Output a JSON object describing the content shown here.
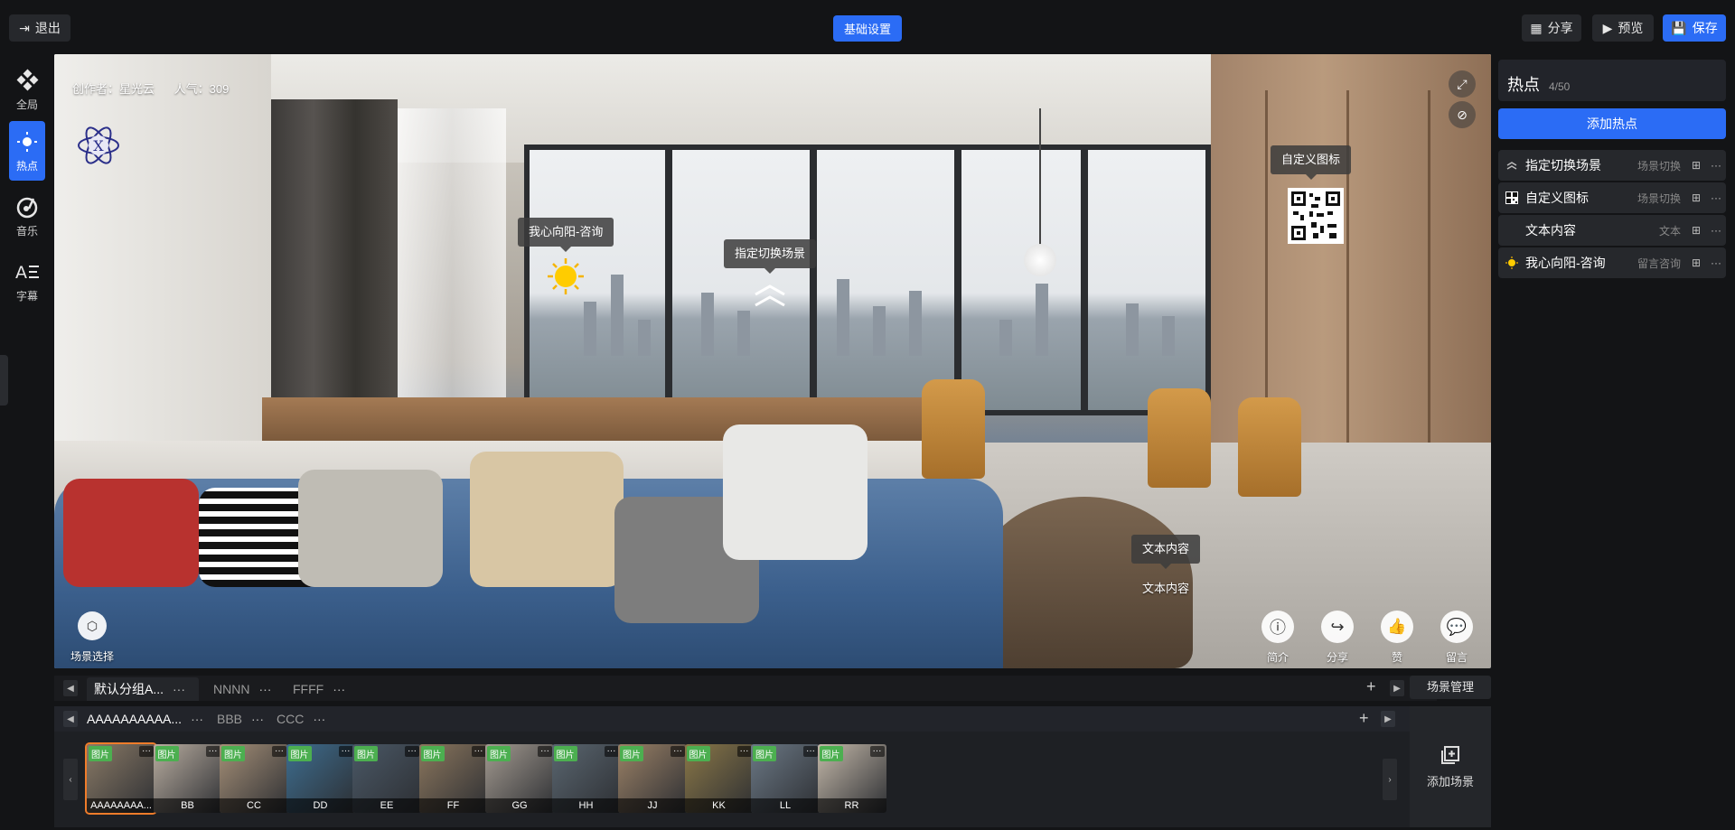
{
  "topbar": {
    "exit_label": "退出",
    "basic_settings_label": "基础设置",
    "share_label": "分享",
    "preview_label": "预览",
    "save_label": "保存"
  },
  "leftnav": [
    {
      "label": "全局",
      "icon": "global-icon"
    },
    {
      "label": "热点",
      "icon": "hotspot-icon",
      "active": true
    },
    {
      "label": "音乐",
      "icon": "music-icon"
    },
    {
      "label": "字幕",
      "icon": "subtitle-icon"
    }
  ],
  "viewer": {
    "creator_label": "创作者：星光云",
    "popularity_label": "人气：309",
    "logo_letter": "X",
    "hotspots": {
      "consult": "我心向阳-咨询",
      "scene_switch": "指定切换场景",
      "custom_icon": "自定义图标",
      "text_tip": "文本内容",
      "text_plain": "文本内容"
    },
    "scene_select_label": "场景选择",
    "actions": {
      "intro": "简介",
      "share": "分享",
      "like": "赞",
      "message": "留言"
    }
  },
  "groups": {
    "tabs": [
      "默认分组A...",
      "NNNN",
      "FFFF"
    ],
    "subtabs": [
      "AAAAAAAAAA...",
      "BBB",
      "CCC"
    ],
    "tag": "图片",
    "more": "···",
    "scenes": [
      "AAAAAAAA...",
      "BB",
      "CC",
      "DD",
      "EE",
      "FF",
      "GG",
      "HH",
      "JJ",
      "KK",
      "LL",
      "RR"
    ],
    "scene_mgmt_label": "场景管理",
    "add_scene_label": "添加场景"
  },
  "hotspot_panel": {
    "title": "热点",
    "count": "4/50",
    "add_label": "添加热点",
    "items": [
      {
        "name": "指定切换场景",
        "type": "场景切换",
        "icon": "chevron-up-icon"
      },
      {
        "name": "自定义图标",
        "type": "场景切换",
        "icon": "qr-icon"
      },
      {
        "name": "文本内容",
        "type": "文本",
        "icon": ""
      },
      {
        "name": "我心向阳-咨询",
        "type": "留言咨询",
        "icon": "sun-icon"
      }
    ]
  }
}
